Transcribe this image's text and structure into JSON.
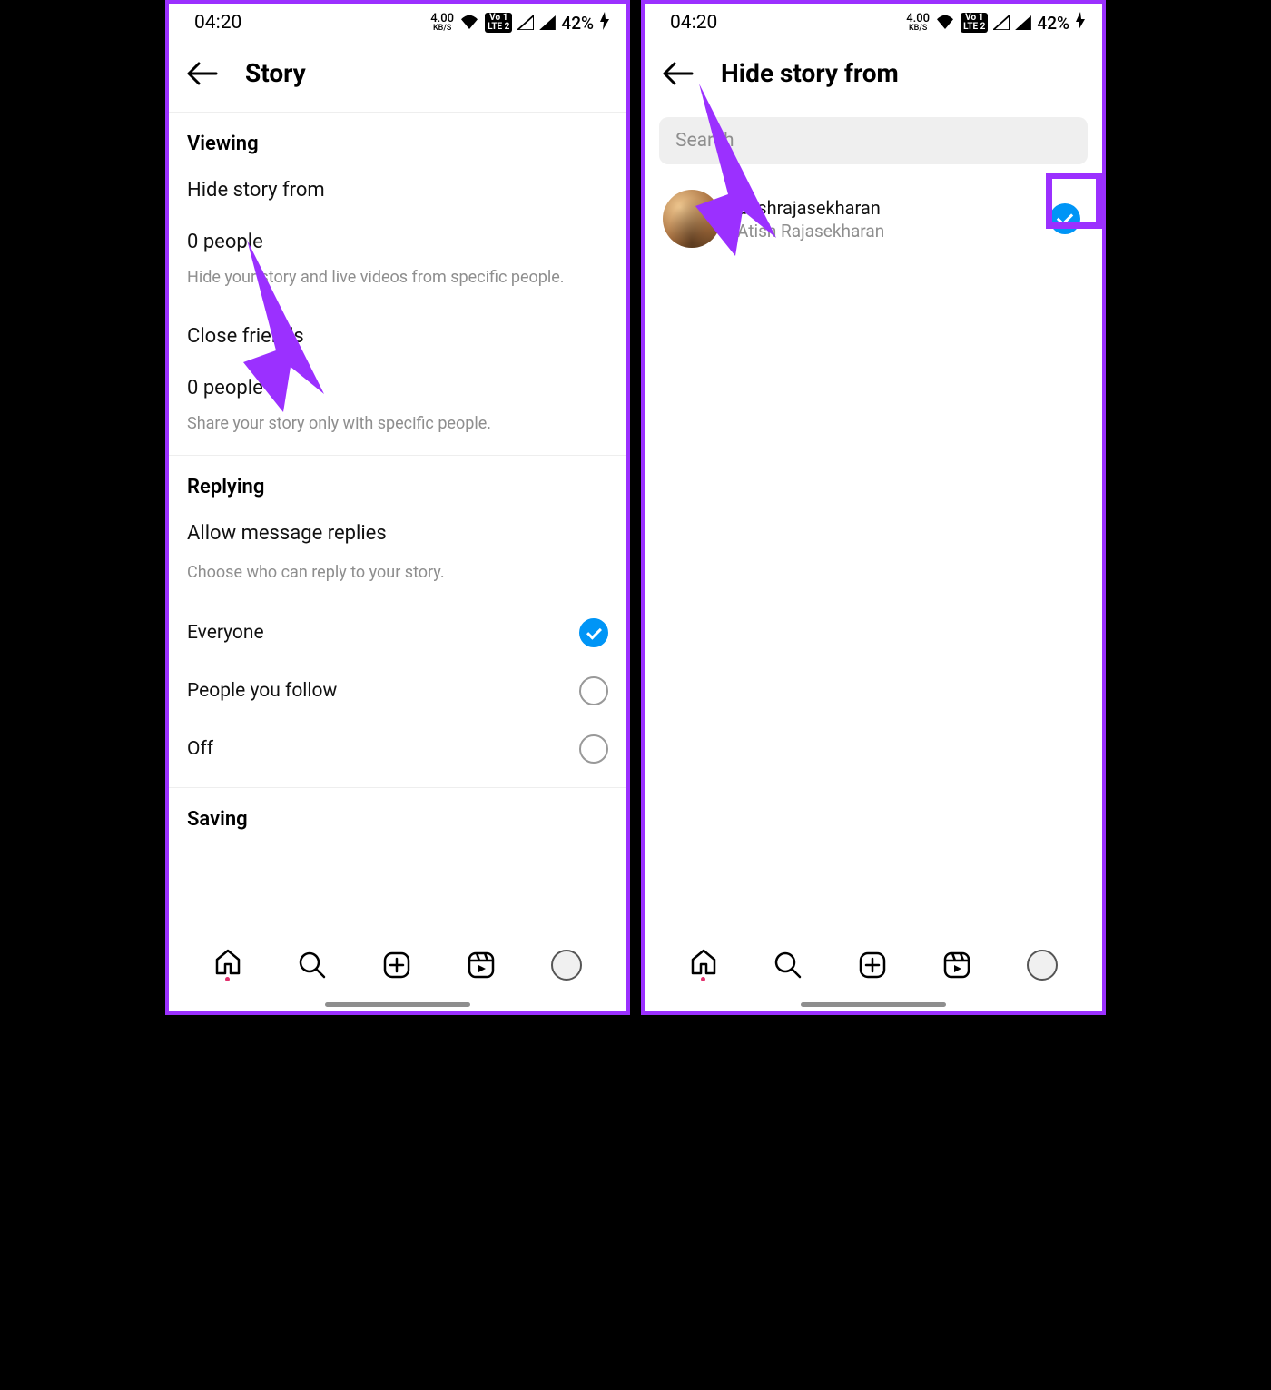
{
  "statusbar": {
    "time": "04:20",
    "speed_value": "4.00",
    "speed_unit": "KB/S",
    "volte1": "Vo 1\nLTE 2",
    "battery_text": "42%"
  },
  "left": {
    "title": "Story",
    "viewing_header": "Viewing",
    "hide_label": "Hide story from",
    "hide_value": "0 people",
    "hide_desc": "Hide your story and live videos from specific people.",
    "close_label": "Close friends",
    "close_value": "0 people",
    "close_desc": "Share your story only with specific people.",
    "replying_header": "Replying",
    "replies_label": "Allow message replies",
    "replies_desc": "Choose who can reply to your story.",
    "radio": {
      "everyone": "Everyone",
      "follow": "People you follow",
      "off": "Off"
    },
    "saving_header": "Saving"
  },
  "right": {
    "title": "Hide story from",
    "search_placeholder": "Search",
    "user": {
      "username": "atishrajasekharan",
      "fullname": "Atish Rajasekharan"
    }
  }
}
